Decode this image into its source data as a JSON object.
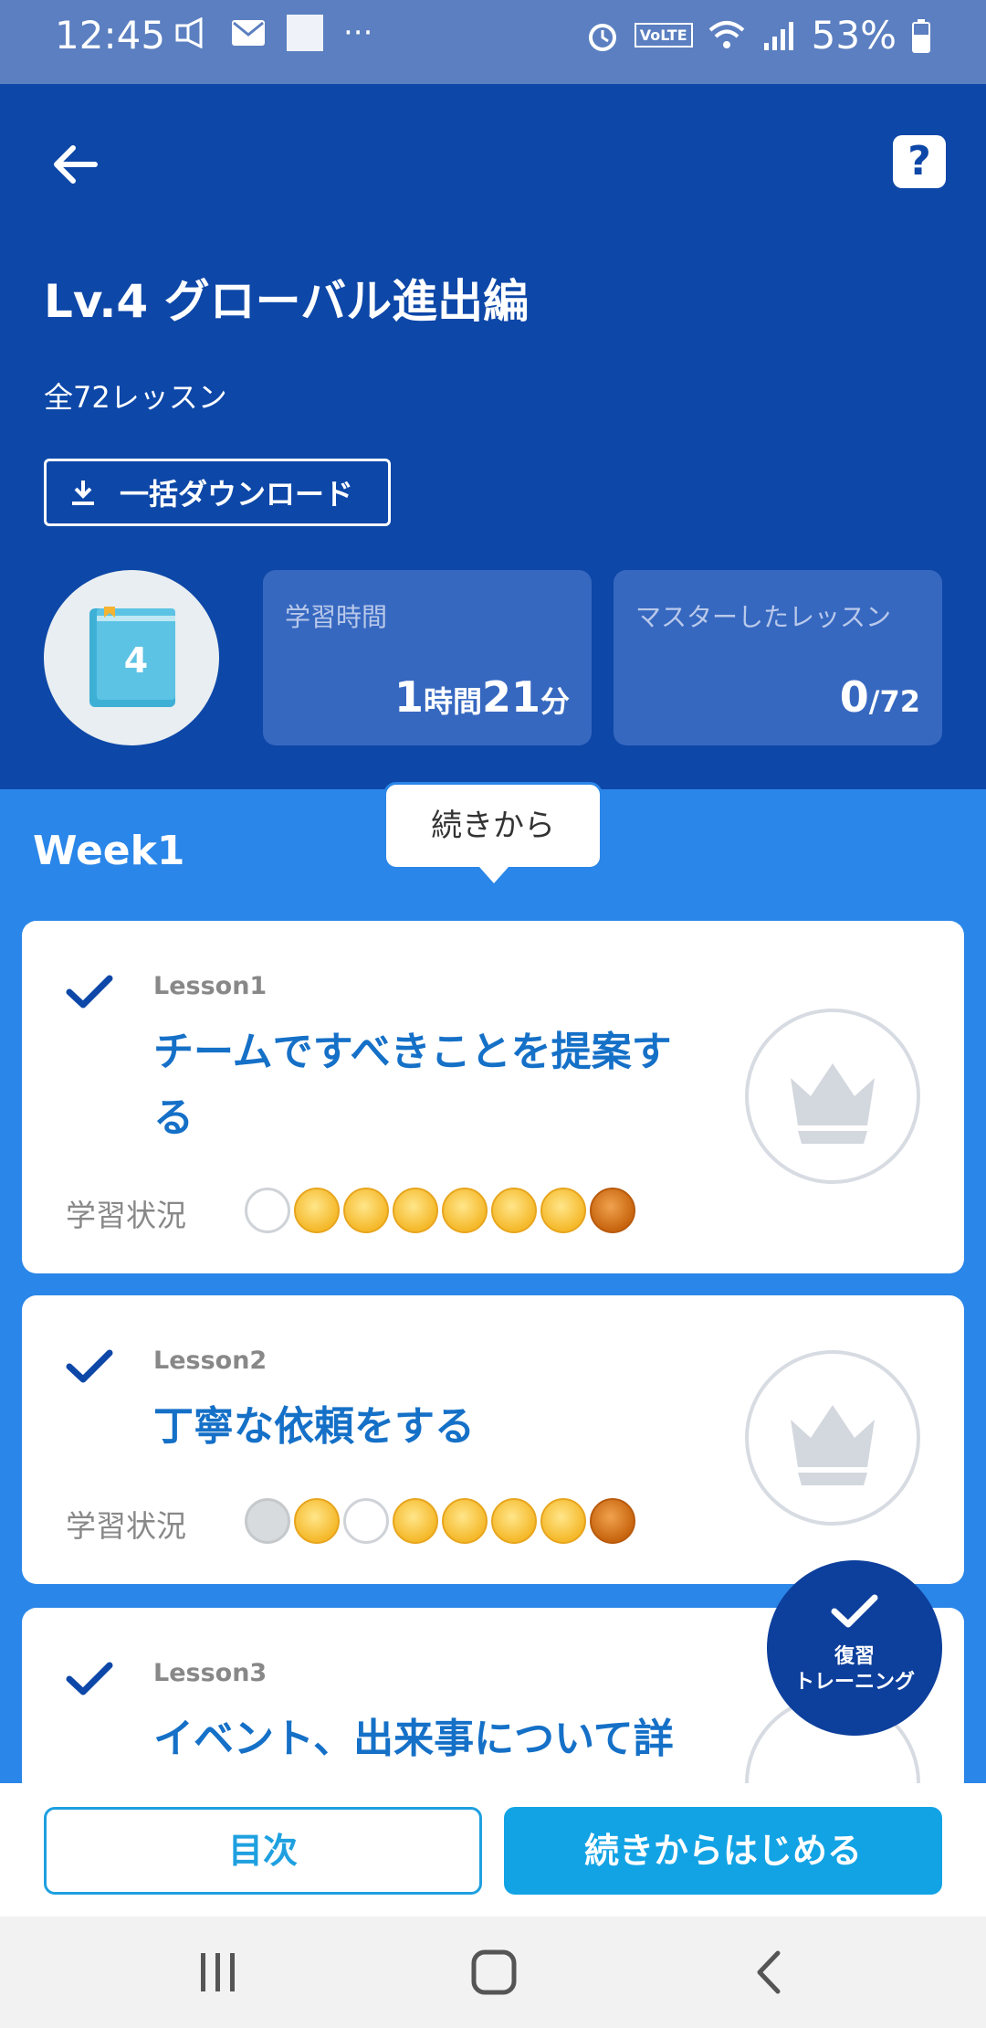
{
  "status_bar": {
    "time": "12:45",
    "battery": "53%",
    "more": "···",
    "left_icons": [
      "speaker-icon",
      "mail-icon",
      "square-icon"
    ],
    "right_icons": [
      "alarm-icon",
      "volte-icon",
      "wifi-icon",
      "signal-icon",
      "battery-icon"
    ],
    "volte": "VoLTE"
  },
  "header": {
    "title": "Lv.4 グローバル進出編",
    "lesson_count": "全72レッスン",
    "download_label": "一括ダウンロード",
    "help_label": "?",
    "book_number": "4",
    "study_time": {
      "label": "学習時間",
      "h_num": "1",
      "h_unit": "時間",
      "m_num": "21",
      "m_unit": "分"
    },
    "mastered": {
      "label": "マスターしたレッスン",
      "count": "0",
      "total": "/72"
    }
  },
  "week": {
    "title": "Week1",
    "tooltip": "続きから"
  },
  "status_label": "学習状況",
  "lessons": [
    {
      "number": "Lesson1",
      "name": "チームですべきことを提案する",
      "medals": [
        "empty",
        "gold",
        "gold",
        "gold",
        "gold",
        "gold",
        "gold",
        "bronze"
      ]
    },
    {
      "number": "Lesson2",
      "name": "丁寧な依頼をする",
      "medals": [
        "gray",
        "gold",
        "empty",
        "gold",
        "gold",
        "gold",
        "gold",
        "bronze"
      ]
    },
    {
      "number": "Lesson3",
      "name": "イベント、出来事について詳",
      "medals": []
    }
  ],
  "fab": {
    "line1": "復習",
    "line2": "トレーニング"
  },
  "bottom": {
    "toc_label": "目次",
    "continue_label": "続きからはじめる"
  },
  "colors": {
    "header_bg": "#0d47a8",
    "body_bg": "#2a86e8",
    "accent": "#12a3e5",
    "lesson_title": "#1570c7"
  }
}
